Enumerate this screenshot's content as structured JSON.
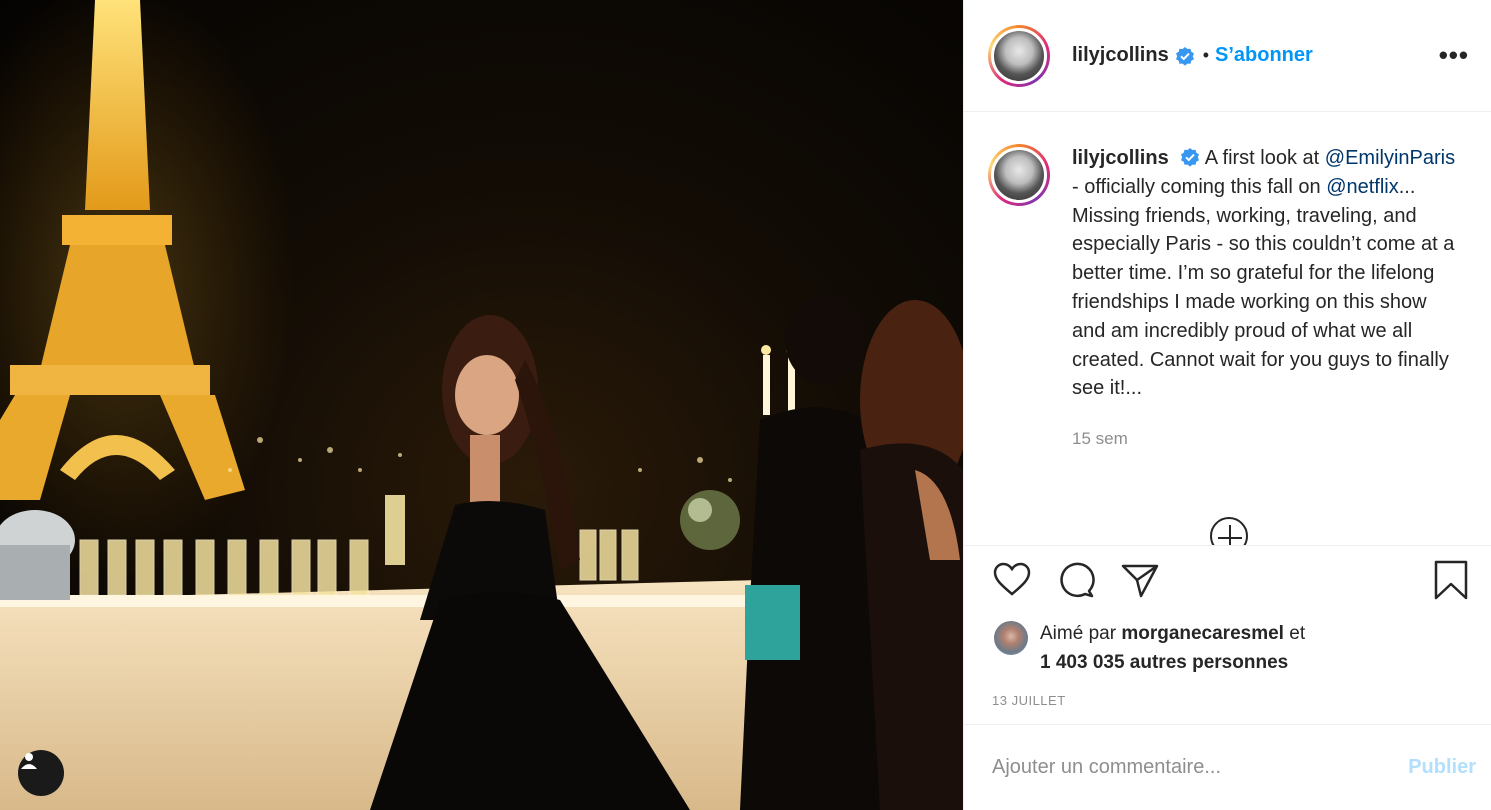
{
  "header": {
    "username": "lilyjcollins",
    "separator": "•",
    "follow_label": "S’abonner",
    "more_label": "•••"
  },
  "caption": {
    "username": "lilyjcollins",
    "text_1": "A first look at ",
    "mention_1": "@EmilyinParis",
    "text_2": " - officially coming this fall on ",
    "mention_2": "@netflix",
    "text_3": "... Missing friends, working, traveling, and especially Paris - so this couldn’t come at a better time. I’m so grateful for the lifelong friendships I made working on this show and am incredibly proud of what we all created. Cannot wait for you guys to finally see it!...",
    "time": "15 sem"
  },
  "likes": {
    "prefix": "Aimé par ",
    "user": "morganecaresmel",
    "suffix": " et",
    "count": "1 403 035 autres personnes"
  },
  "date": "13 JUILLET",
  "comment": {
    "placeholder": "Ajouter un commentaire...",
    "publish_label": "Publier"
  },
  "colors": {
    "accent": "#0095f6",
    "verified": "#3897f0",
    "link": "#00376b",
    "muted": "#8e8e8e",
    "publish_disabled": "#b2dffc"
  },
  "icons": [
    "verified-badge-icon",
    "heart-icon",
    "comment-icon",
    "share-icon",
    "bookmark-icon",
    "user-tag-icon",
    "load-more-icon"
  ]
}
